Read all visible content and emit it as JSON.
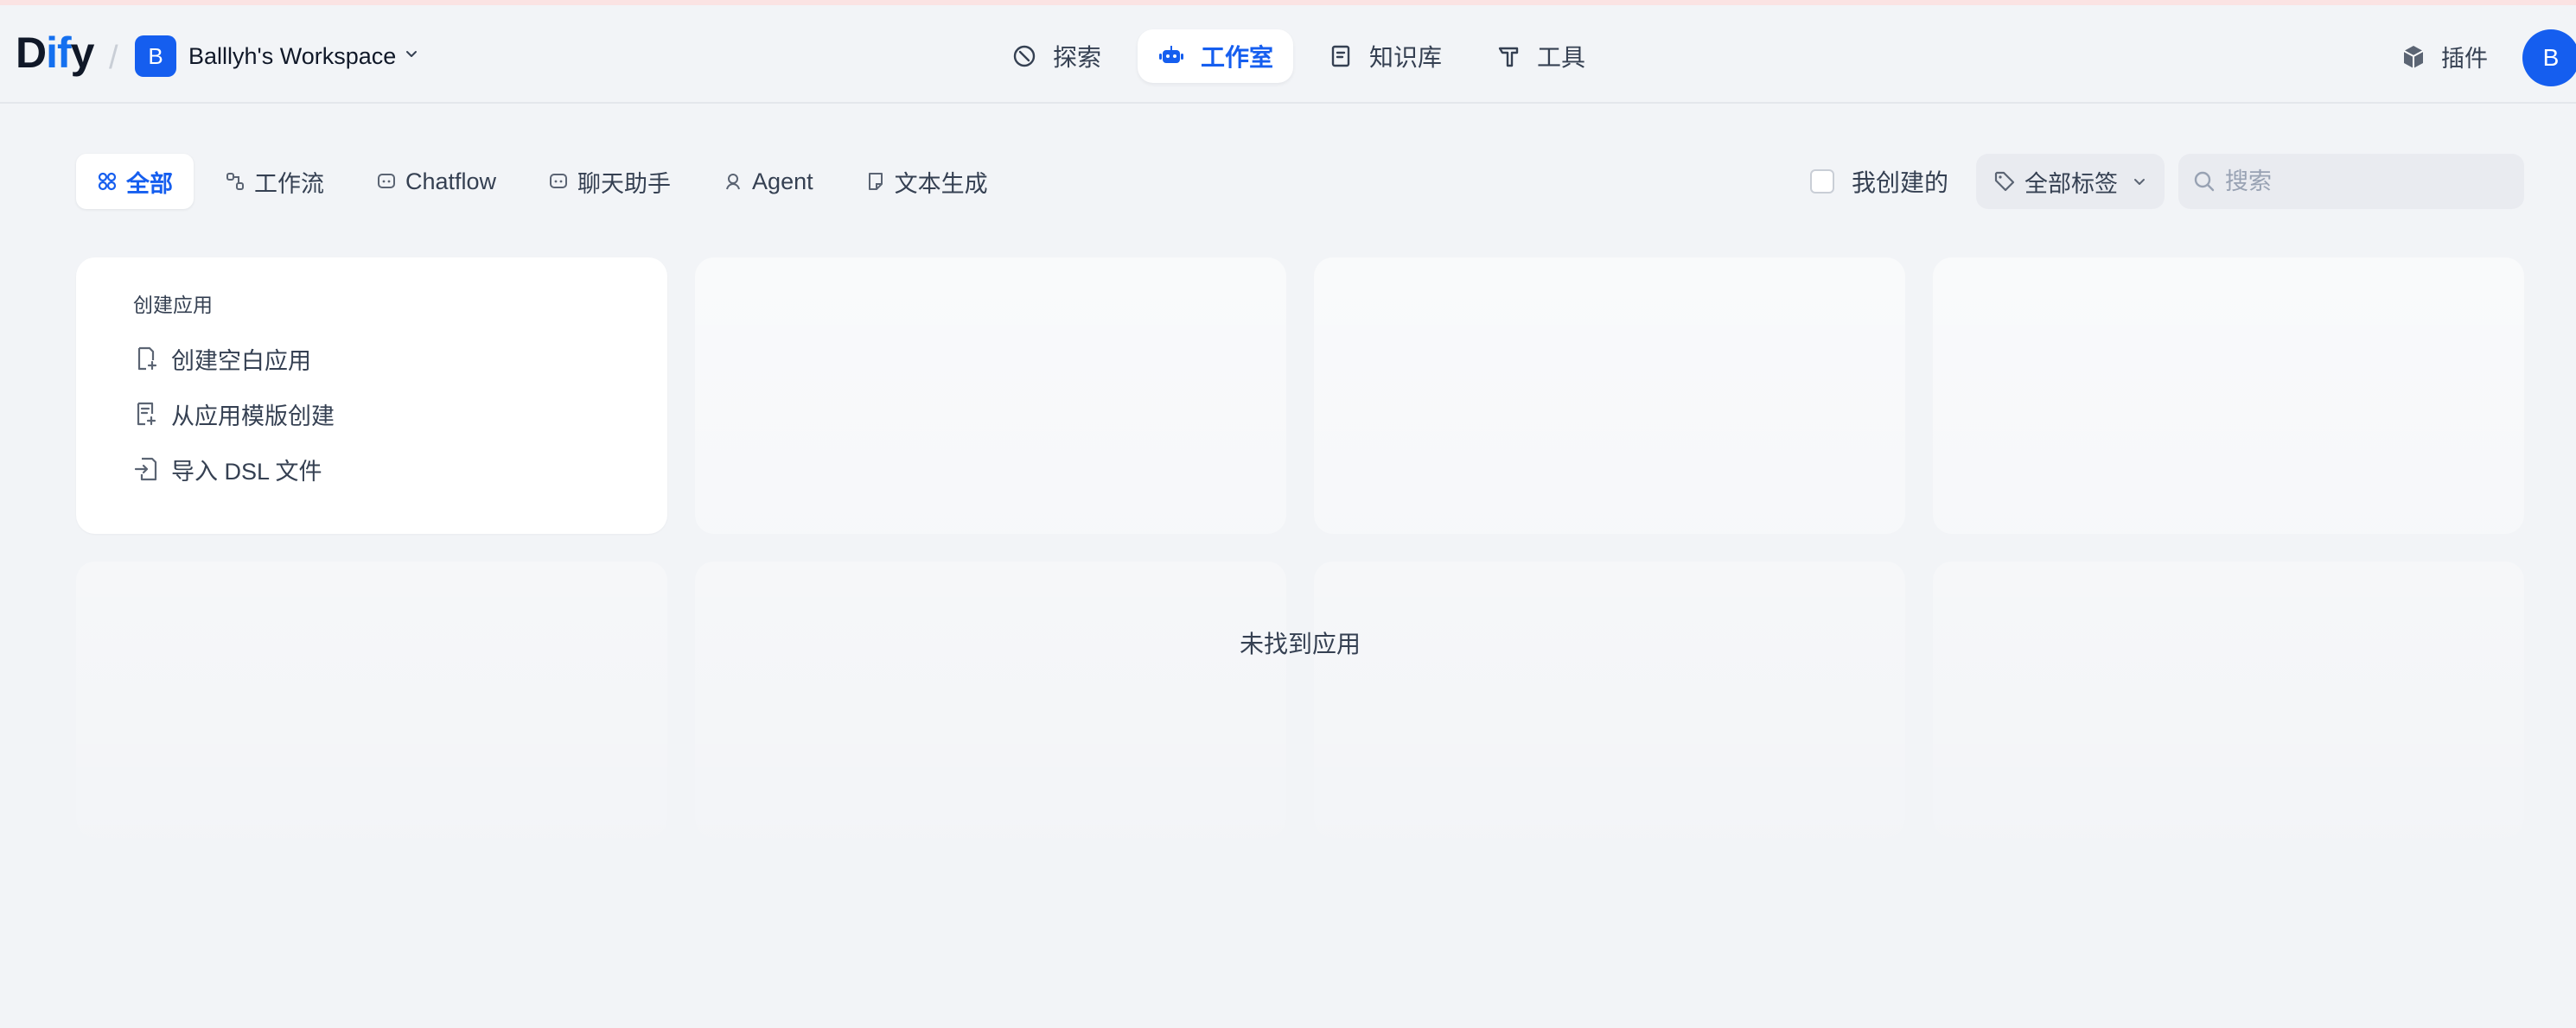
{
  "header": {
    "logo_prefix": "D",
    "logo_mid": "if",
    "logo_suffix": "y",
    "workspace_initial": "B",
    "workspace_name": "Balllyh's Workspace",
    "nav": {
      "explore": "探索",
      "studio": "工作室",
      "knowledge": "知识库",
      "tools": "工具"
    },
    "plugins": "插件",
    "user_initial": "B"
  },
  "tabs": [
    "全部",
    "工作流",
    "Chatflow",
    "聊天助手",
    "Agent",
    "文本生成"
  ],
  "filters": {
    "created_by_me": "我创建的",
    "all_tags": "全部标签",
    "search_placeholder": "搜索"
  },
  "create_card": {
    "title": "创建应用",
    "blank": "创建空白应用",
    "from_template": "从应用模版创建",
    "import_dsl": "导入 DSL 文件"
  },
  "empty_message": "未找到应用",
  "colors": {
    "accent": "#155eef",
    "background": "#f2f4f7"
  }
}
